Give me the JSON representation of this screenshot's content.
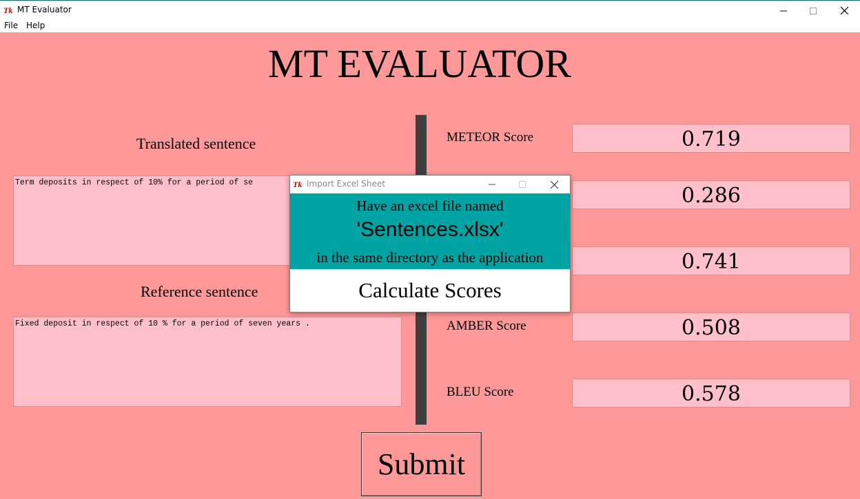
{
  "window": {
    "title": "MT Evaluator",
    "icon": "tk-feather-icon"
  },
  "menu": {
    "file": "File",
    "help": "Help"
  },
  "main": {
    "heading": "MT EVALUATOR",
    "translated_label": "Translated sentence",
    "translated_text": "Term deposits in respect of 10% for a period of se",
    "reference_label": "Reference sentence",
    "reference_text": "Fixed deposit in respect of 10 % for a period of seven years .",
    "submit_label": "Submit"
  },
  "scores": [
    {
      "label": "METEOR Score",
      "value": "0.719"
    },
    {
      "label": "",
      "value": "0.286"
    },
    {
      "label": "",
      "value": "0.741"
    },
    {
      "label": "AMBER Score",
      "value": "0.508"
    },
    {
      "label": "BLEU Score",
      "value": "0.578"
    }
  ],
  "dialog": {
    "title": "Import Excel Sheet",
    "line1": "Have an excel file named",
    "line2": "'Sentences.xlsx'",
    "line3": "in the same directory as the application",
    "button": "Calculate Scores"
  },
  "colors": {
    "background": "#ff9999",
    "field": "#ffc0cb",
    "dialog_accent": "#00a3a3",
    "divider": "#3f3f3f"
  }
}
